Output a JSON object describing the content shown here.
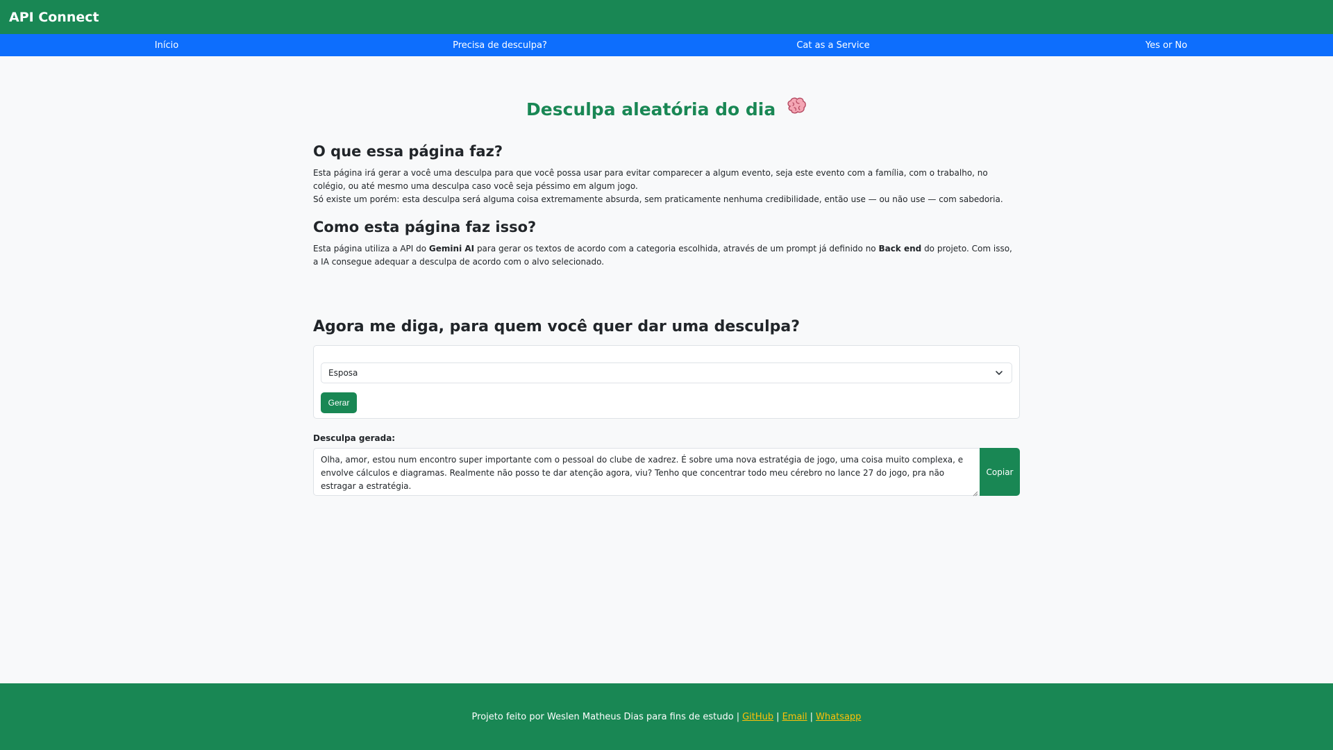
{
  "header": {
    "brand": "API Connect"
  },
  "nav": {
    "items": [
      {
        "label": "Início"
      },
      {
        "label": "Precisa de desculpa?"
      },
      {
        "label": "Cat as a Service"
      },
      {
        "label": "Yes or No"
      }
    ]
  },
  "main": {
    "title": "Desculpa aleatória do dia",
    "title_icon": "brain-icon",
    "what": {
      "heading": "O que essa página faz?",
      "line1": "Esta página irá gerar a você uma desculpa para que você possa usar para evitar comparecer a algum evento, seja este evento com a família, com o trabalho, no colégio, ou até mesmo uma desculpa caso você seja péssimo em algum jogo.",
      "line2": "Só existe um porém: esta desculpa será alguma coisa extremamente absurda, sem praticamente nenhuma credibilidade, então use — ou não use — com sabedoria."
    },
    "how": {
      "heading": "Como esta página faz isso?",
      "text_1": "Esta página utiliza a API do ",
      "bold_1": "Gemini AI",
      "text_2": " para gerar os textos de acordo com a categoria escolhida, através de um prompt já definido no ",
      "bold_2": "Back end",
      "text_3": " do projeto. Com isso, a IA consegue adequar a desculpa de acordo com o alvo selecionado."
    },
    "ask": {
      "heading": "Agora me diga, para quem você quer dar uma desculpa?"
    },
    "form": {
      "selected": "Esposa",
      "generate_label": "Gerar"
    },
    "result": {
      "label": "Desculpa gerada:",
      "text": "Olha, amor,  estou num encontro super importante com o pessoal do clube de xadrez.  É sobre uma nova estratégia de jogo, uma coisa muito complexa,  e envolve cálculos e diagramas.  Realmente não posso te dar atenção agora, viu?  Tenho que concentrar todo meu cérebro no lance 27 do jogo, pra não estragar a estratégia.",
      "copy_label": "Copiar"
    }
  },
  "footer": {
    "text": "Projeto feito por Weslen Matheus Dias para fins de estudo",
    "separator": "|",
    "links": [
      {
        "label": "GitHub"
      },
      {
        "label": "Email"
      },
      {
        "label": "Whatsapp"
      }
    ]
  },
  "colors": {
    "header_bg": "#198754",
    "nav_bg": "#0d6efd",
    "title_color": "#198754",
    "footer_link": "#ffc107",
    "page_bg": "#f8f9fa"
  }
}
